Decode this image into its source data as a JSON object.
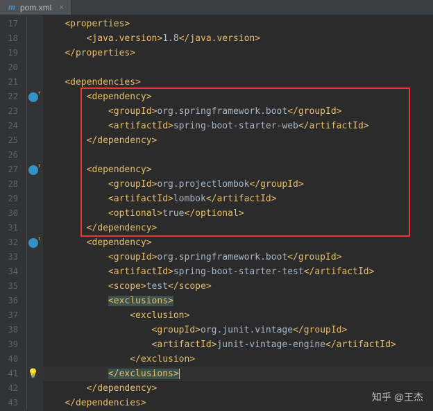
{
  "tab": {
    "filename": "pom.xml",
    "icon": "m"
  },
  "line_numbers": [
    "17",
    "18",
    "19",
    "20",
    "21",
    "22",
    "23",
    "24",
    "25",
    "26",
    "27",
    "28",
    "29",
    "30",
    "31",
    "32",
    "33",
    "34",
    "35",
    "36",
    "37",
    "38",
    "39",
    "40",
    "41",
    "42",
    "43"
  ],
  "code": {
    "l17": {
      "indent": "    ",
      "open": "<properties>"
    },
    "l18": {
      "indent": "        ",
      "open": "<java.version>",
      "text": "1.8",
      "close": "</java.version>"
    },
    "l19": {
      "indent": "    ",
      "close": "</properties>"
    },
    "l20": {
      "indent": ""
    },
    "l21": {
      "indent": "    ",
      "open": "<dependencies>"
    },
    "l22": {
      "indent": "        ",
      "open": "<dependency>"
    },
    "l23": {
      "indent": "            ",
      "open": "<groupId>",
      "text": "org.springframework.boot",
      "close": "</groupId>"
    },
    "l24": {
      "indent": "            ",
      "open": "<artifactId>",
      "text": "spring-boot-starter-web",
      "close": "</artifactId>"
    },
    "l25": {
      "indent": "        ",
      "close": "</dependency>"
    },
    "l26": {
      "indent": ""
    },
    "l27": {
      "indent": "        ",
      "open": "<dependency>"
    },
    "l28": {
      "indent": "            ",
      "open": "<groupId>",
      "text": "org.projectlombok",
      "close": "</groupId>"
    },
    "l29": {
      "indent": "            ",
      "open": "<artifactId>",
      "text": "lombok",
      "close": "</artifactId>"
    },
    "l30": {
      "indent": "            ",
      "open": "<optional>",
      "text": "true",
      "close": "</optional>"
    },
    "l31": {
      "indent": "        ",
      "close": "</dependency>"
    },
    "l32": {
      "indent": "        ",
      "open": "<dependency>"
    },
    "l33": {
      "indent": "            ",
      "open": "<groupId>",
      "text": "org.springframework.boot",
      "close": "</groupId>"
    },
    "l34": {
      "indent": "            ",
      "open": "<artifactId>",
      "text": "spring-boot-starter-test",
      "close": "</artifactId>"
    },
    "l35": {
      "indent": "            ",
      "open": "<scope>",
      "text": "test",
      "close": "</scope>"
    },
    "l36": {
      "indent": "            ",
      "open": "<exclusions>"
    },
    "l37": {
      "indent": "                ",
      "open": "<exclusion>"
    },
    "l38": {
      "indent": "                    ",
      "open": "<groupId>",
      "text": "org.junit.vintage",
      "close": "</groupId>"
    },
    "l39": {
      "indent": "                    ",
      "open": "<artifactId>",
      "text": "junit-vintage-engine",
      "close": "</artifactId>"
    },
    "l40": {
      "indent": "                ",
      "close": "</exclusion>"
    },
    "l41": {
      "indent": "            ",
      "close": "</exclusions>"
    },
    "l42": {
      "indent": "        ",
      "close": "</dependency>"
    },
    "l43": {
      "indent": "    ",
      "close": "</dependencies>"
    }
  },
  "watermark": "知乎 @王杰",
  "colors": {
    "bg": "#2b2b2b",
    "gutter": "#313335",
    "tag": "#e8bf6a",
    "text": "#a9b7c6",
    "red_box": "#e83535"
  }
}
